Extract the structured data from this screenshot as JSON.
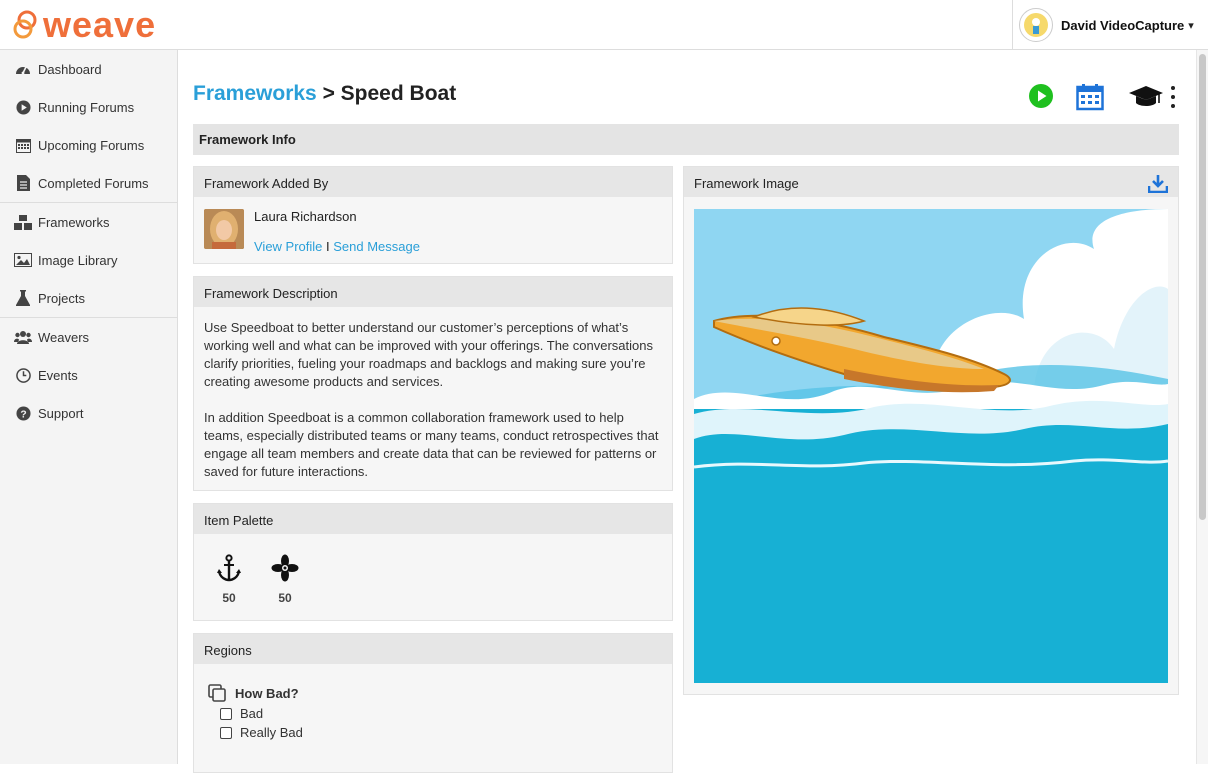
{
  "app": {
    "logo_text": "weave"
  },
  "user": {
    "name": "David VideoCapture",
    "caret": "▾"
  },
  "sidebar": {
    "items": [
      {
        "label": "Dashboard",
        "icon": "dashboard-icon"
      },
      {
        "label": "Running Forums",
        "icon": "play-circle-icon"
      },
      {
        "label": "Upcoming Forums",
        "icon": "calendar-icon"
      },
      {
        "label": "Completed Forums",
        "icon": "document-icon"
      },
      {
        "label": "Frameworks",
        "icon": "cubes-icon"
      },
      {
        "label": "Image Library",
        "icon": "image-icon"
      },
      {
        "label": "Projects",
        "icon": "flask-icon"
      },
      {
        "label": "Weavers",
        "icon": "users-icon"
      },
      {
        "label": "Events",
        "icon": "clock-icon"
      },
      {
        "label": "Support",
        "icon": "question-icon"
      }
    ]
  },
  "breadcrumb": {
    "link": "Frameworks",
    "separator": " > ",
    "current": "Speed Boat"
  },
  "section": {
    "title": "Framework Info"
  },
  "added_by": {
    "heading": "Framework Added By",
    "name": "Laura Richardson",
    "view_profile": "View Profile",
    "divider": " I ",
    "send_message": "Send Message"
  },
  "description": {
    "heading": "Framework Description",
    "para1": "Use Speedboat to better understand our customer’s perceptions of what’s working well and what can be improved with your offerings. The conversations clarify priorities, fueling your roadmaps and backlogs and making sure you’re creating awesome products and services.",
    "para2": "In addition Speedboat is a common collaboration framework used to help teams, especially distributed teams or many teams, conduct retrospectives that engage all team members and create data that can be reviewed for patterns or saved for future interactions."
  },
  "palette": {
    "heading": "Item Palette",
    "items": [
      {
        "icon": "anchor-icon",
        "count": "50"
      },
      {
        "icon": "propeller-icon",
        "count": "50"
      }
    ]
  },
  "regions": {
    "heading": "Regions",
    "groups": [
      {
        "title": "How Bad?",
        "options": [
          "Bad",
          "Really Bad"
        ]
      }
    ]
  },
  "image_panel": {
    "heading": "Framework Image"
  },
  "colors": {
    "accent": "#2a9fd8",
    "brand": "#ef6f3a",
    "sea": "#17b0d4",
    "sky": "#8fd6f2",
    "play": "#1fc01f"
  }
}
